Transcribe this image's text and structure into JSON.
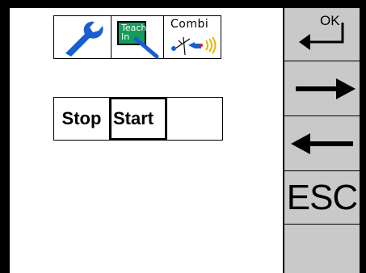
{
  "toolbar": {
    "icons": [
      {
        "name": "wrench-icon",
        "color": "#1a5fd1"
      },
      {
        "name": "teach-in-icon",
        "label": "Teach In",
        "color": "#169c5a"
      },
      {
        "name": "combi-icon",
        "label": "Combi"
      }
    ]
  },
  "mode_selector": {
    "options": [
      "Stop",
      "Start",
      ""
    ],
    "selected": "Start"
  },
  "side_buttons": {
    "ok_label": "OK",
    "next": "right-arrow-icon",
    "back": "left-arrow-icon",
    "esc_label": "ESC"
  },
  "colors": {
    "side_panel": "#c9c9c9",
    "wrench": "#1a5fd1",
    "teach": "#169c5a"
  }
}
